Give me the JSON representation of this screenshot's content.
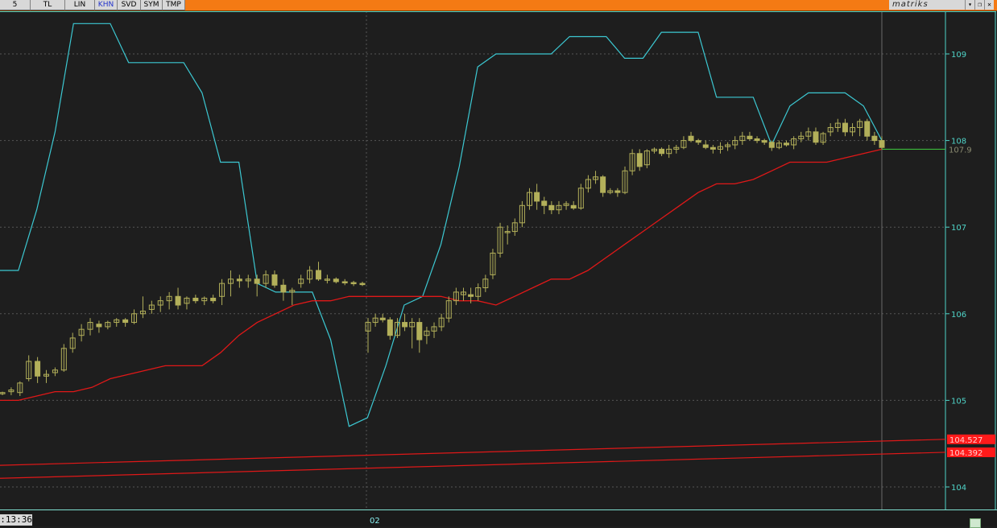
{
  "toolbar": {
    "buttons": [
      {
        "label": "5",
        "active": false
      },
      {
        "label": "TL",
        "active": false
      },
      {
        "label": "LIN",
        "active": false
      },
      {
        "label": "KHN",
        "active": true
      },
      {
        "label": "SVD",
        "active": false
      },
      {
        "label": "SYM",
        "active": false
      },
      {
        "label": "TMP",
        "active": false
      }
    ],
    "brand": "matriks",
    "window_controls": {
      "dropdown": "▾",
      "minimize": "▬",
      "restore": "❐",
      "close": "✕"
    }
  },
  "footer": {
    "clock": ":13:36",
    "x_tick": "02"
  },
  "chart_data": {
    "type": "candlestick",
    "y_ticks": [
      104,
      105,
      106,
      107,
      108,
      109
    ],
    "ylim": [
      103.8,
      109.5
    ],
    "grid": true,
    "price_label": "107.9",
    "level_labels": [
      "104.527",
      "104.392"
    ],
    "colors": {
      "background": "#1e1e1e",
      "candle": "#b3b05a",
      "upper_band": "#3cc8d2",
      "lower_band": "#e01818",
      "price_line": "#3fcf3f",
      "axis": "#4fd4c8",
      "grid": "#555555"
    },
    "upper_band": [
      106.5,
      106.5,
      107.2,
      108.1,
      109.35,
      109.35,
      109.35,
      108.9,
      108.9,
      108.9,
      108.9,
      108.55,
      107.75,
      107.75,
      106.35,
      106.25,
      106.25,
      106.25,
      105.7,
      104.7,
      104.8,
      105.4,
      106.1,
      106.2,
      106.8,
      107.7,
      108.85,
      109.0,
      109.0,
      109.0,
      109.0,
      109.2,
      109.2,
      109.2,
      108.95,
      108.95,
      109.25,
      109.25,
      109.25,
      108.5,
      108.5,
      108.5,
      107.95,
      108.4,
      108.55,
      108.55,
      108.55,
      108.4,
      108.0
    ],
    "lower_band": [
      105.0,
      105.0,
      105.05,
      105.1,
      105.1,
      105.15,
      105.25,
      105.3,
      105.35,
      105.4,
      105.4,
      105.4,
      105.55,
      105.75,
      105.9,
      106.0,
      106.1,
      106.15,
      106.15,
      106.2,
      106.2,
      106.2,
      106.2,
      106.2,
      106.2,
      106.15,
      106.15,
      106.1,
      106.2,
      106.3,
      106.4,
      106.4,
      106.5,
      106.65,
      106.8,
      106.95,
      107.1,
      107.25,
      107.4,
      107.5,
      107.5,
      107.55,
      107.65,
      107.75,
      107.75,
      107.75,
      107.8,
      107.85,
      107.9
    ],
    "level_lines": [
      {
        "y_start": 104.25,
        "y_end": 104.55
      },
      {
        "y_start": 104.1,
        "y_end": 104.4
      }
    ],
    "candles": [
      [
        105.08,
        105.1,
        105.06,
        105.09
      ],
      [
        105.1,
        105.15,
        105.06,
        105.12
      ],
      [
        105.09,
        105.22,
        105.05,
        105.2
      ],
      [
        105.25,
        105.52,
        105.22,
        105.45
      ],
      [
        105.45,
        105.5,
        105.2,
        105.28
      ],
      [
        105.28,
        105.35,
        105.2,
        105.3
      ],
      [
        105.32,
        105.38,
        105.28,
        105.35
      ],
      [
        105.35,
        105.65,
        105.33,
        105.6
      ],
      [
        105.6,
        105.78,
        105.55,
        105.72
      ],
      [
        105.75,
        105.88,
        105.68,
        105.82
      ],
      [
        105.82,
        105.95,
        105.75,
        105.9
      ],
      [
        105.88,
        105.92,
        105.78,
        105.85
      ],
      [
        105.85,
        105.92,
        105.82,
        105.9
      ],
      [
        105.9,
        105.95,
        105.85,
        105.93
      ],
      [
        105.93,
        105.95,
        105.85,
        105.9
      ],
      [
        105.9,
        106.05,
        105.88,
        106.0
      ],
      [
        106.0,
        106.2,
        105.95,
        106.03
      ],
      [
        106.05,
        106.15,
        106.0,
        106.1
      ],
      [
        106.1,
        106.2,
        106.02,
        106.15
      ],
      [
        106.15,
        106.25,
        106.05,
        106.2
      ],
      [
        106.2,
        106.3,
        106.05,
        106.1
      ],
      [
        106.12,
        106.2,
        106.05,
        106.18
      ],
      [
        106.18,
        106.22,
        106.12,
        106.15
      ],
      [
        106.15,
        106.2,
        106.1,
        106.18
      ],
      [
        106.18,
        106.22,
        106.12,
        106.15
      ],
      [
        106.2,
        106.4,
        106.1,
        106.35
      ],
      [
        106.35,
        106.5,
        106.2,
        106.4
      ],
      [
        106.4,
        106.45,
        106.3,
        106.38
      ],
      [
        106.38,
        106.45,
        106.3,
        106.4
      ],
      [
        106.4,
        106.45,
        106.2,
        106.35
      ],
      [
        106.35,
        106.5,
        106.3,
        106.45
      ],
      [
        106.45,
        106.5,
        106.3,
        106.33
      ],
      [
        106.33,
        106.4,
        106.15,
        106.25
      ],
      [
        106.25,
        106.3,
        106.1,
        106.27
      ],
      [
        106.35,
        106.45,
        106.3,
        106.4
      ],
      [
        106.4,
        106.55,
        106.35,
        106.5
      ],
      [
        106.5,
        106.6,
        106.38,
        106.4
      ],
      [
        106.4,
        106.45,
        106.35,
        106.4
      ],
      [
        106.4,
        106.42,
        106.35,
        106.37
      ],
      [
        106.37,
        106.4,
        106.33,
        106.36
      ],
      [
        106.36,
        106.38,
        106.32,
        106.35
      ],
      [
        106.35,
        106.37,
        106.32,
        106.34
      ],
      [
        105.8,
        105.95,
        105.55,
        105.9
      ],
      [
        105.9,
        106.0,
        105.85,
        105.95
      ],
      [
        105.95,
        106.0,
        105.9,
        105.93
      ],
      [
        105.93,
        105.96,
        105.7,
        105.75
      ],
      [
        105.75,
        105.95,
        105.72,
        105.9
      ],
      [
        105.9,
        106.0,
        105.8,
        105.85
      ],
      [
        105.85,
        105.95,
        105.6,
        105.9
      ],
      [
        105.9,
        105.95,
        105.55,
        105.7
      ],
      [
        105.75,
        105.85,
        105.65,
        105.8
      ],
      [
        105.8,
        105.9,
        105.72,
        105.85
      ],
      [
        105.85,
        106.0,
        105.8,
        105.95
      ],
      [
        105.95,
        106.2,
        105.9,
        106.15
      ],
      [
        106.15,
        106.3,
        106.1,
        106.25
      ],
      [
        106.22,
        106.3,
        106.15,
        106.25
      ],
      [
        106.22,
        106.3,
        106.12,
        106.2
      ],
      [
        106.2,
        106.35,
        106.15,
        106.3
      ],
      [
        106.3,
        106.45,
        106.25,
        106.4
      ],
      [
        106.45,
        106.75,
        106.4,
        106.7
      ],
      [
        106.7,
        107.05,
        106.65,
        107.0
      ],
      [
        106.95,
        107.02,
        106.8,
        106.95
      ],
      [
        106.95,
        107.1,
        106.9,
        107.05
      ],
      [
        107.05,
        107.3,
        107.0,
        107.25
      ],
      [
        107.25,
        107.45,
        107.2,
        107.4
      ],
      [
        107.4,
        107.5,
        107.2,
        107.3
      ],
      [
        107.3,
        107.35,
        107.15,
        107.25
      ],
      [
        107.25,
        107.3,
        107.15,
        107.2
      ],
      [
        107.2,
        107.3,
        107.15,
        107.25
      ],
      [
        107.25,
        107.3,
        107.2,
        107.27
      ],
      [
        107.25,
        107.3,
        107.2,
        107.22
      ],
      [
        107.22,
        107.5,
        107.2,
        107.45
      ],
      [
        107.45,
        107.6,
        107.4,
        107.55
      ],
      [
        107.55,
        107.65,
        107.5,
        107.58
      ],
      [
        107.58,
        107.6,
        107.35,
        107.4
      ],
      [
        107.4,
        107.45,
        107.38,
        107.42
      ],
      [
        107.42,
        107.45,
        107.35,
        107.4
      ],
      [
        107.4,
        107.7,
        107.38,
        107.65
      ],
      [
        107.65,
        107.9,
        107.6,
        107.85
      ],
      [
        107.85,
        107.9,
        107.65,
        107.7
      ],
      [
        107.72,
        107.9,
        107.68,
        107.88
      ],
      [
        107.88,
        107.92,
        107.85,
        107.9
      ],
      [
        107.9,
        107.92,
        107.82,
        107.85
      ],
      [
        107.85,
        107.95,
        107.8,
        107.9
      ],
      [
        107.9,
        107.95,
        107.85,
        107.92
      ],
      [
        107.92,
        108.05,
        107.9,
        108.0
      ],
      [
        108.05,
        108.1,
        107.98,
        108.0
      ],
      [
        108.0,
        108.02,
        107.95,
        107.98
      ],
      [
        107.95,
        108.0,
        107.9,
        107.92
      ],
      [
        107.92,
        107.95,
        107.85,
        107.9
      ],
      [
        107.9,
        107.98,
        107.85,
        107.93
      ],
      [
        107.93,
        107.98,
        107.88,
        107.95
      ],
      [
        107.95,
        108.05,
        107.9,
        108.0
      ],
      [
        108.0,
        108.1,
        107.95,
        108.05
      ],
      [
        108.05,
        108.1,
        108.0,
        108.02
      ],
      [
        108.02,
        108.05,
        107.97,
        108.0
      ],
      [
        108.0,
        108.02,
        107.95,
        107.98
      ],
      [
        107.98,
        108.0,
        107.88,
        107.92
      ],
      [
        107.92,
        108.0,
        107.9,
        107.97
      ],
      [
        107.97,
        108.0,
        107.93,
        107.95
      ],
      [
        107.95,
        108.05,
        107.9,
        108.02
      ],
      [
        108.02,
        108.1,
        107.98,
        108.05
      ],
      [
        108.05,
        108.15,
        108.0,
        108.1
      ],
      [
        108.1,
        108.15,
        107.95,
        107.98
      ],
      [
        107.98,
        108.1,
        107.95,
        108.08
      ],
      [
        108.1,
        108.2,
        108.05,
        108.15
      ],
      [
        108.15,
        108.25,
        108.1,
        108.2
      ],
      [
        108.2,
        108.25,
        108.05,
        108.1
      ],
      [
        108.1,
        108.2,
        108.05,
        108.15
      ],
      [
        108.15,
        108.25,
        108.05,
        108.22
      ],
      [
        108.22,
        108.25,
        108.0,
        108.05
      ],
      [
        108.05,
        108.1,
        107.95,
        108.0
      ],
      [
        108.0,
        108.05,
        107.9,
        107.92
      ]
    ]
  }
}
